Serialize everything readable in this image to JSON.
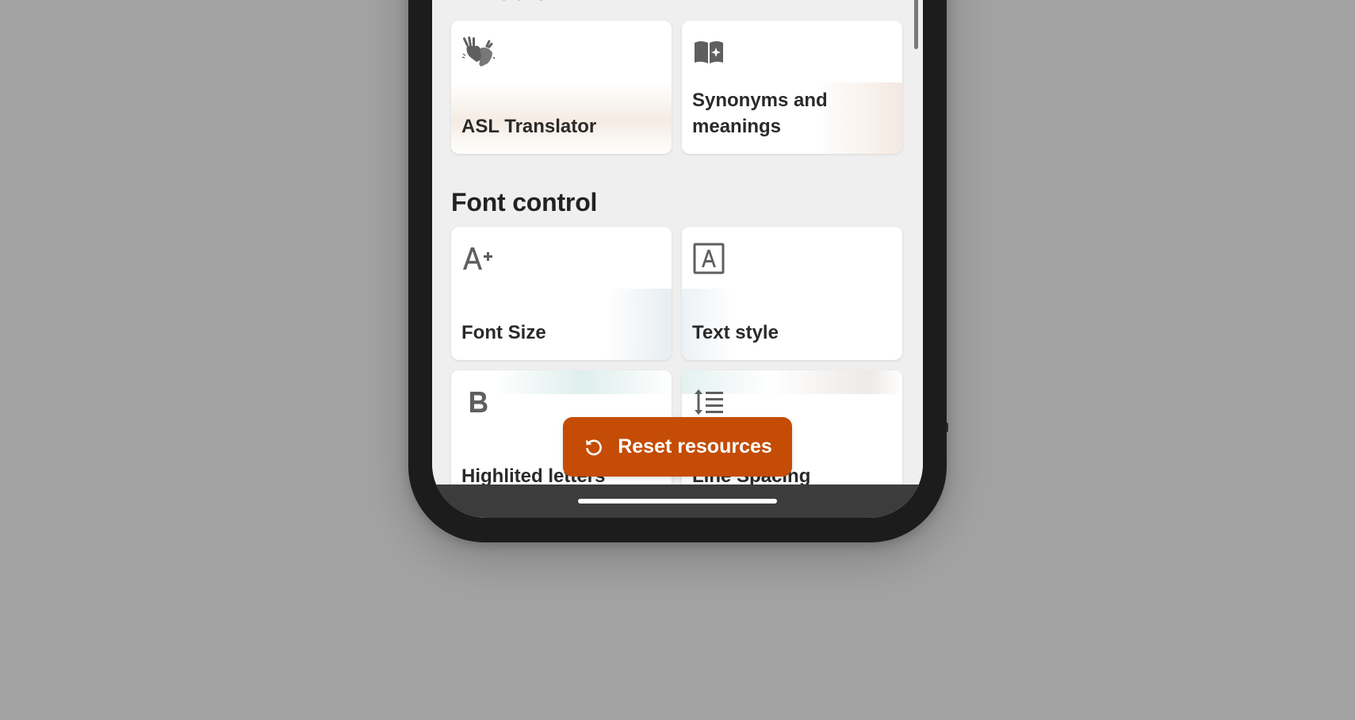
{
  "sections": {
    "ai_tools": {
      "title": "AI Tools"
    },
    "font_control": {
      "title": "Font control"
    }
  },
  "cards": {
    "asl_translator": {
      "label": "ASL Translator",
      "icon": "sign-language-icon"
    },
    "synonyms": {
      "label": "Synonyms and meanings",
      "icon": "book-sparkle-icon"
    },
    "font_size": {
      "label": "Font Size",
      "icon": "font-size-increase-icon"
    },
    "text_style": {
      "label": "Text style",
      "icon": "text-style-icon"
    },
    "highlighted_letters": {
      "label": "Highlited letters",
      "icon": "bold-icon"
    },
    "line_spacing": {
      "label": "Line Spacing",
      "icon": "line-spacing-icon"
    }
  },
  "reset_button": {
    "label": "Reset resources",
    "icon": "reset-icon"
  },
  "colors": {
    "accent": "#c44c05",
    "screen_background": "#efefef",
    "card_background": "#ffffff",
    "text": "#2a2a2a",
    "icon": "#5f5f5f",
    "stage_background": "#a3a3a3"
  }
}
